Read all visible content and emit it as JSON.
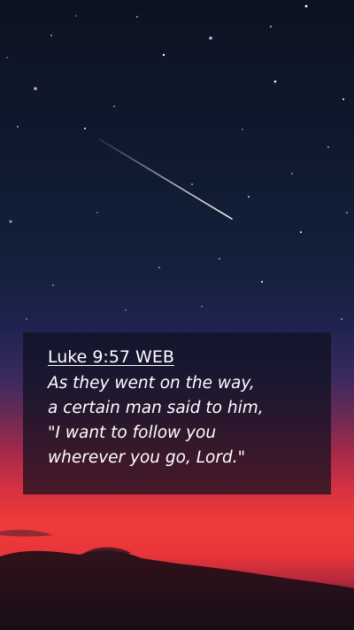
{
  "verse": {
    "reference": "Luke 9:57 WEB",
    "lines": [
      "As they went on the way,",
      "a certain man said to him,",
      "\"I want to follow you",
      "wherever you go, Lord.\""
    ]
  },
  "colors": {
    "sky_top": "#0c1220",
    "horizon_red": "#ee3b3a",
    "card_background": "rgba(14,16,30,0.72)",
    "text": "#ffffff"
  }
}
